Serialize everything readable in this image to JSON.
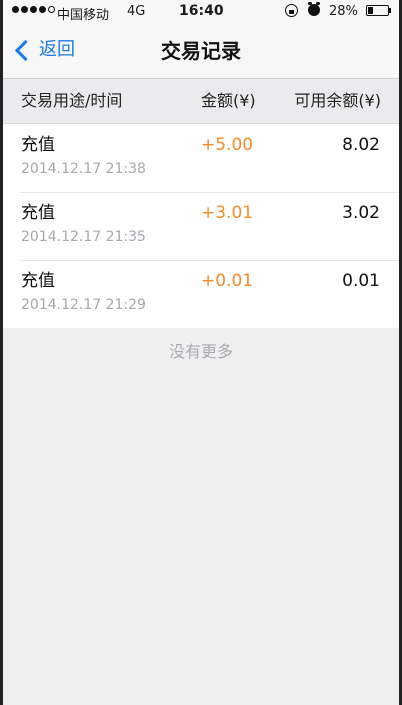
{
  "status_bar": {
    "carrier": "中国移动",
    "network": "4G",
    "time": "16:40",
    "battery": "28%",
    "battery_level": 0.28,
    "signal_bars": 4,
    "icons": [
      "orientation-lock-icon",
      "alarm-icon"
    ]
  },
  "nav": {
    "back_label": "返回",
    "title": "交易记录",
    "accent_color": "#1b7ce3"
  },
  "table": {
    "headers": {
      "purpose": "交易用途/时间",
      "amount": "金额(¥)",
      "balance": "可用余额(¥)"
    },
    "rows": [
      {
        "purpose": "充值",
        "time": "2014.12.17 21:38",
        "amount": "+5.00",
        "balance": "8.02"
      },
      {
        "purpose": "充值",
        "time": "2014.12.17 21:35",
        "amount": "+3.01",
        "balance": "3.02"
      },
      {
        "purpose": "充值",
        "time": "2014.12.17 21:29",
        "amount": "+0.01",
        "balance": "0.01"
      }
    ],
    "amount_color": "#f58b2b"
  },
  "footer": {
    "no_more": "没有更多"
  }
}
